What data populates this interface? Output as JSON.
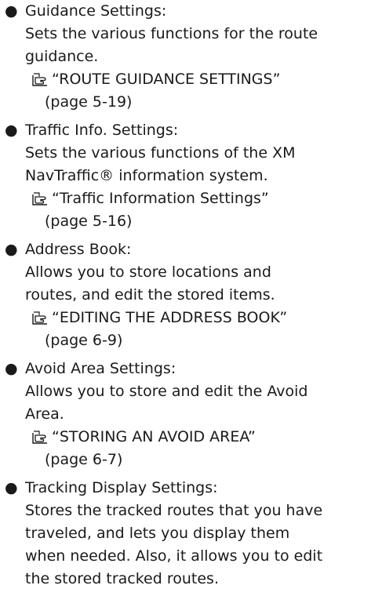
{
  "items": [
    {
      "title": "Guidance Settings:",
      "desc_lines": [
        "Sets the various functions for the route",
        "guidance."
      ],
      "ref_title": "“ROUTE GUIDANCE SETTINGS”",
      "ref_page": "(page 5-19)"
    },
    {
      "title": "Traffic Info. Settings:",
      "desc_lines": [
        "Sets the various functions of the XM",
        "NavTraffic® information system."
      ],
      "ref_title": "“Traffic Information Settings”",
      "ref_page": "(page 5-16)"
    },
    {
      "title": "Address Book:",
      "desc_lines": [
        "Allows you to store locations and",
        "routes, and edit the stored items."
      ],
      "ref_title": "“EDITING THE ADDRESS BOOK”",
      "ref_page": "(page 6-9)"
    },
    {
      "title": "Avoid Area Settings:",
      "desc_lines": [
        "Allows you to store and edit the Avoid",
        "Area."
      ],
      "ref_title": "“STORING AN AVOID AREA”",
      "ref_page": "(page 6-7)"
    },
    {
      "title": "Tracking Display Settings:",
      "desc_lines": [
        "Stores the tracked routes that you have",
        "traveled, and lets you display them",
        "when needed. Also, it allows you to edit",
        "the stored tracked routes."
      ]
    }
  ],
  "bullet_glyph": "●",
  "icons": {
    "reference": "pointing-hand-book-icon"
  }
}
